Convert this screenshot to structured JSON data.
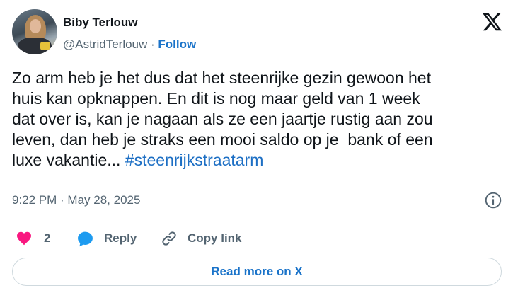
{
  "author": {
    "name": "Biby Terlouw",
    "handle": "@AstridTerlouw",
    "separator": " · ",
    "follow_label": "Follow"
  },
  "brand": {
    "logo_icon": "x-logo-icon"
  },
  "tweet": {
    "text": "Zo arm heb je het dus dat het steenrijke gezin gewoon het\nhuis kan opknappen. En dit is nog maar geld van 1 week\ndat over is, kan je nagaan als ze een jaartje rustig aan zou\nleven, dan heb je straks een mooi saldo op je  bank of een\nluxe vakantie... ",
    "hashtag": "#steenrijkstraatarm",
    "timestamp": "9:22 PM · May 28, 2025"
  },
  "actions": {
    "like_count": "2",
    "reply_label": "Reply",
    "copy_link_label": "Copy link"
  },
  "footer": {
    "read_more_label": "Read more on X"
  },
  "colors": {
    "like": "#f91880",
    "reply": "#1d9bf0",
    "link": "#1a73c9",
    "muted": "#536471",
    "text": "#0f1419"
  }
}
